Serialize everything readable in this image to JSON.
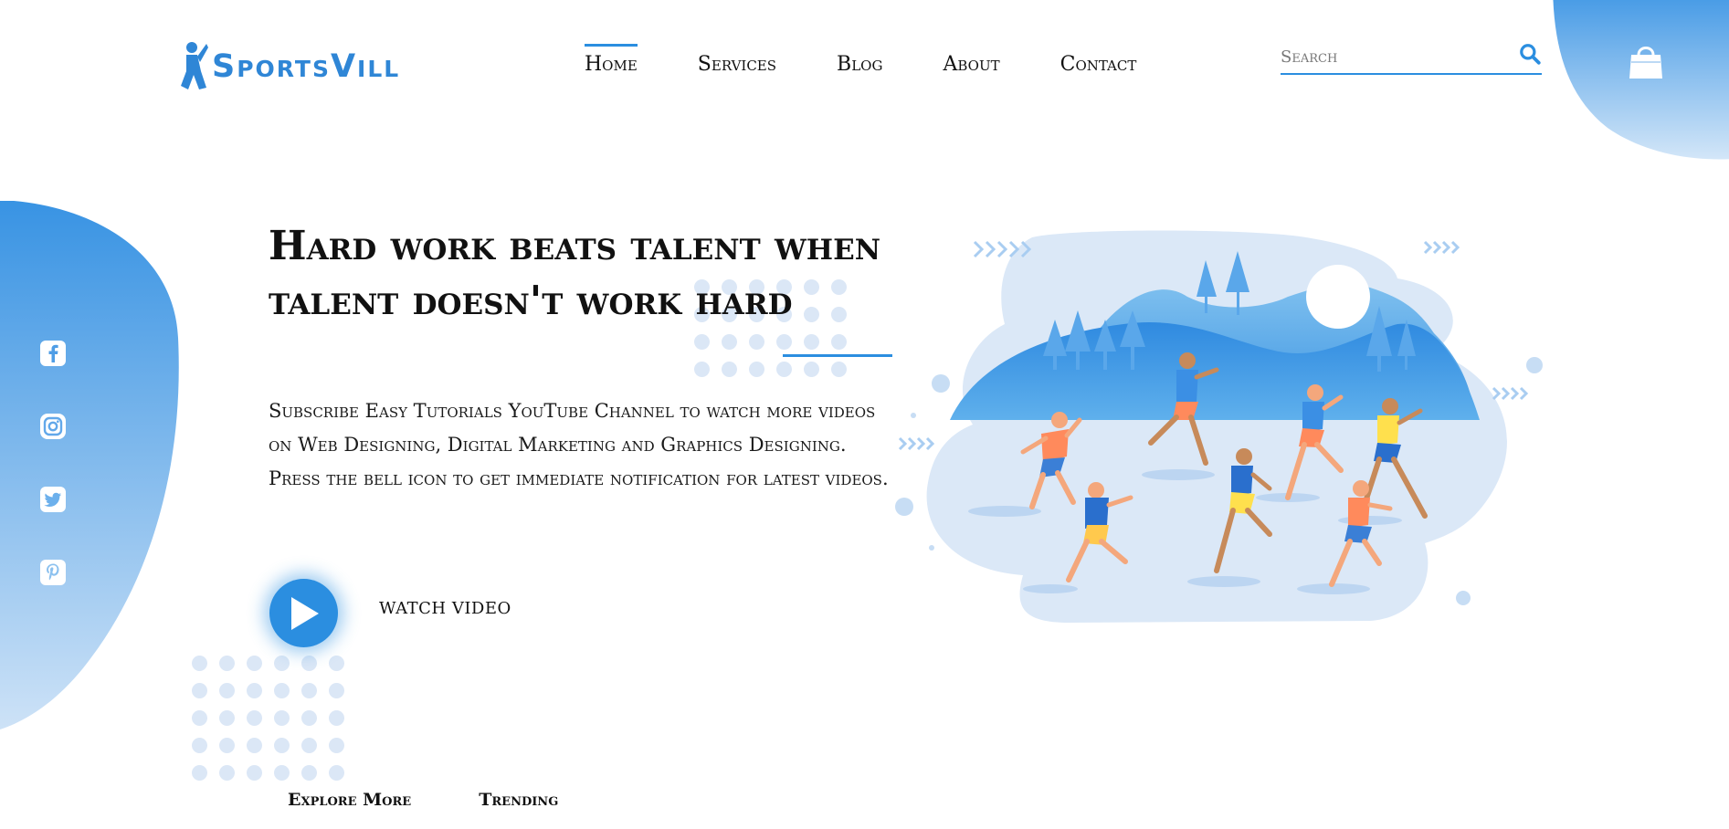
{
  "brand": {
    "logo_text": "SportsVill"
  },
  "nav": {
    "items": [
      {
        "label": "Home",
        "active": true
      },
      {
        "label": "Services",
        "active": false
      },
      {
        "label": "Blog",
        "active": false
      },
      {
        "label": "About",
        "active": false
      },
      {
        "label": "Contact",
        "active": false
      }
    ]
  },
  "search": {
    "placeholder": "Search",
    "icon": "search-icon"
  },
  "cart": {
    "icon": "shopping-bag-icon"
  },
  "social": [
    "facebook-icon",
    "instagram-icon",
    "twitter-icon",
    "pinterest-icon"
  ],
  "hero": {
    "title_line1": "Hard work beats talent when",
    "title_line2": "talent doesn't work hard",
    "description": "Subscribe Easy Tutorials YouTube Channel to watch more videos on Web Designing, Digital Marketing and Graphics Designing. Press the bell icon to get immediate notification for latest videos.",
    "play_label": "WATCH VIDEO"
  },
  "footer_links": {
    "explore": "Explore More",
    "trending": "Trending"
  },
  "colors": {
    "accent": "#2b8ee0",
    "blob_top": "#3893e3",
    "blob_bottom": "#cfe3f7",
    "dot": "#dbe7f6"
  }
}
